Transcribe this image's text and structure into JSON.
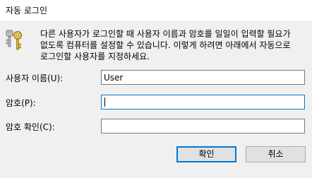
{
  "window": {
    "title": "자동 로그인"
  },
  "description": "다른 사용자가 로그인할 때 사용자 이름과 암호를 일일이 입력할 필요가 없도록 컴퓨터를 설정할 수 있습니다. 이렇게 하려면 아래에서 자동으로 로그인할 사용자를 지정하세요.",
  "icon": "keys-icon",
  "fields": {
    "username": {
      "label": "사용자 이름(U):",
      "value": "User"
    },
    "password": {
      "label": "암호(P):",
      "value": ""
    },
    "confirm_password": {
      "label": "암호 확인(C):",
      "value": ""
    }
  },
  "buttons": {
    "ok_label": "확인",
    "cancel_label": "취소"
  },
  "colors": {
    "focus_border": "#0078d7",
    "button_face": "#e1e1e1",
    "dialog_background": "#f0f0f0"
  }
}
